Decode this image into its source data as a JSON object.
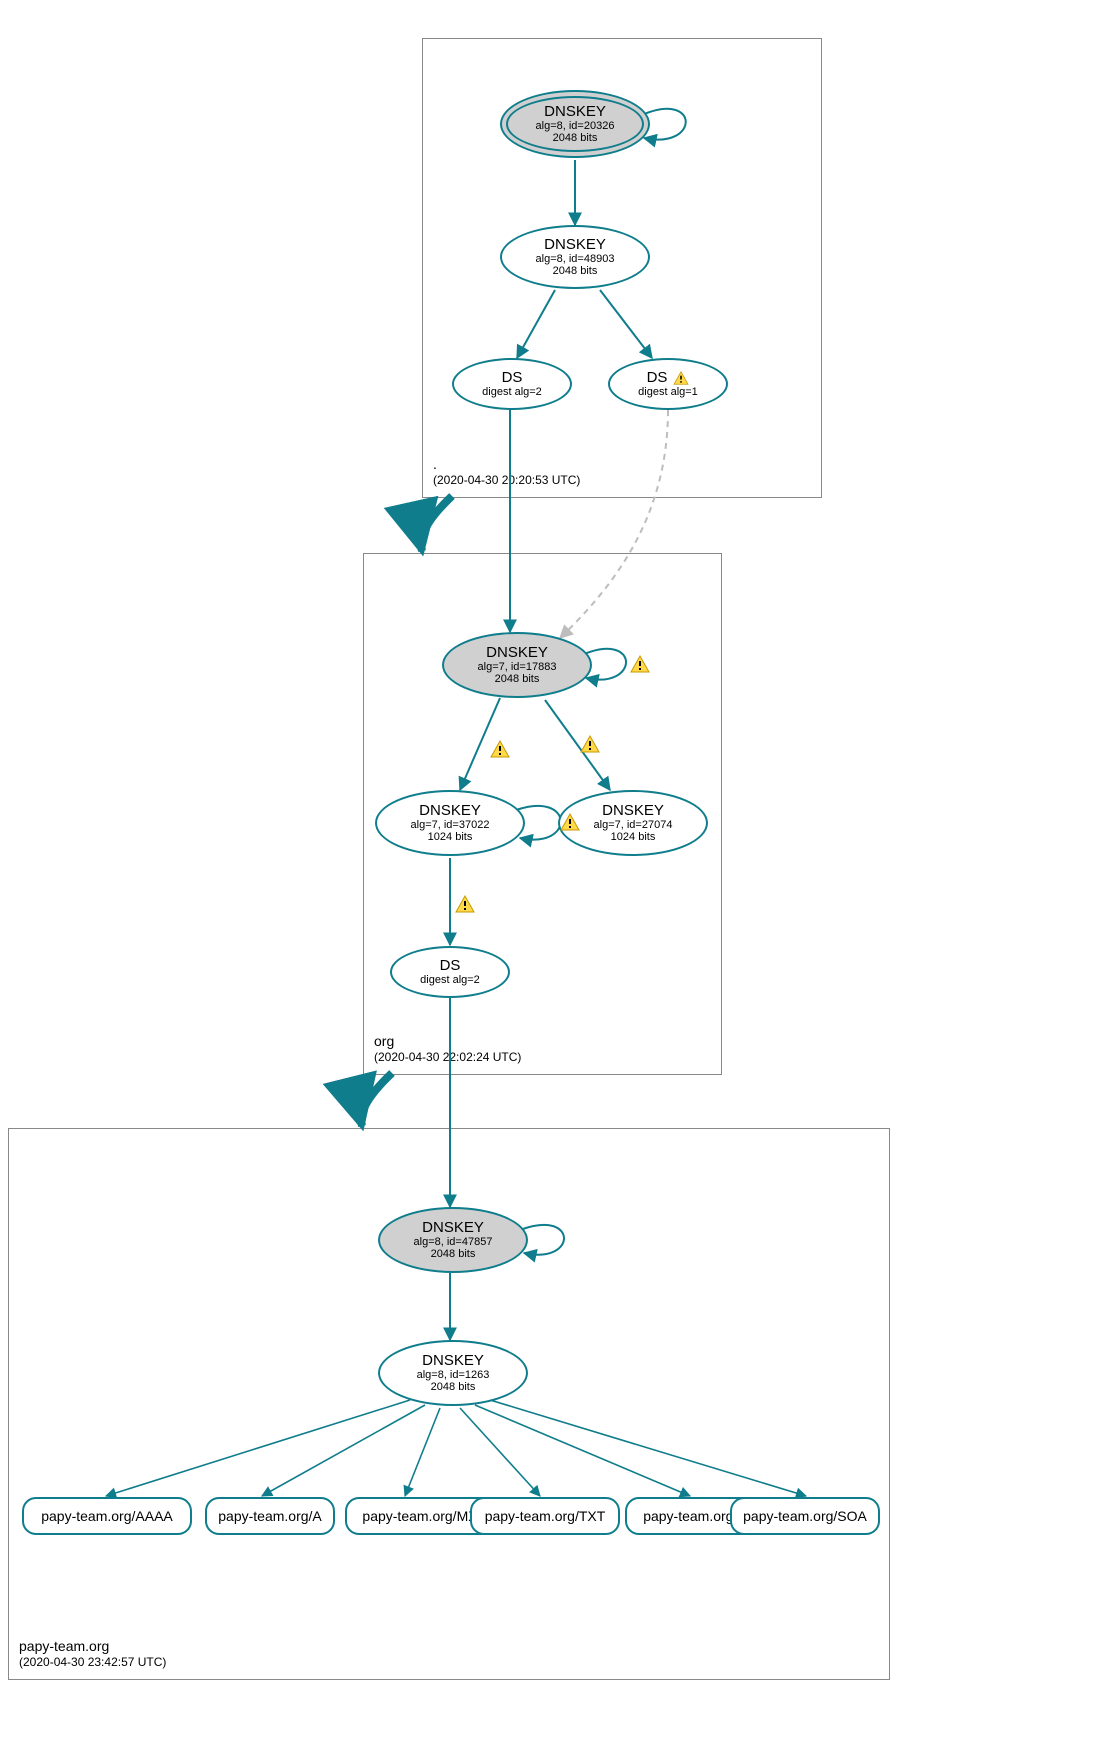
{
  "colors": {
    "edge": "#0f7d8c",
    "edge_dashed": "#bdbdbd",
    "zone_border": "#888888",
    "node_fill_grey": "#d0d0d0"
  },
  "zones": {
    "root": {
      "name": ".",
      "timestamp": "(2020-04-30 20:20:53 UTC)"
    },
    "tld": {
      "name": "org",
      "timestamp": "(2020-04-30 22:02:24 UTC)"
    },
    "domain": {
      "name": "papy-team.org",
      "timestamp": "(2020-04-30 23:42:57 UTC)"
    }
  },
  "nodes": {
    "root_ksk": {
      "title": "DNSKEY",
      "line2": "alg=8, id=20326",
      "line3": "2048 bits"
    },
    "root_zsk": {
      "title": "DNSKEY",
      "line2": "alg=8, id=48903",
      "line3": "2048 bits"
    },
    "root_ds1": {
      "title": "DS",
      "line2": "digest alg=2"
    },
    "root_ds2": {
      "title": "DS",
      "line2": "digest alg=1"
    },
    "org_ksk": {
      "title": "DNSKEY",
      "line2": "alg=7, id=17883",
      "line3": "2048 bits"
    },
    "org_zsk1": {
      "title": "DNSKEY",
      "line2": "alg=7, id=37022",
      "line3": "1024 bits"
    },
    "org_zsk2": {
      "title": "DNSKEY",
      "line2": "alg=7, id=27074",
      "line3": "1024 bits"
    },
    "org_ds": {
      "title": "DS",
      "line2": "digest alg=2"
    },
    "dom_ksk": {
      "title": "DNSKEY",
      "line2": "alg=8, id=47857",
      "line3": "2048 bits"
    },
    "dom_zsk": {
      "title": "DNSKEY",
      "line2": "alg=8, id=1263",
      "line3": "2048 bits"
    }
  },
  "rrsets": {
    "aaaa": "papy-team.org/AAAA",
    "a": "papy-team.org/A",
    "mx": "papy-team.org/MX",
    "txt": "papy-team.org/TXT",
    "ns": "papy-team.org/NS",
    "soa": "papy-team.org/SOA"
  }
}
